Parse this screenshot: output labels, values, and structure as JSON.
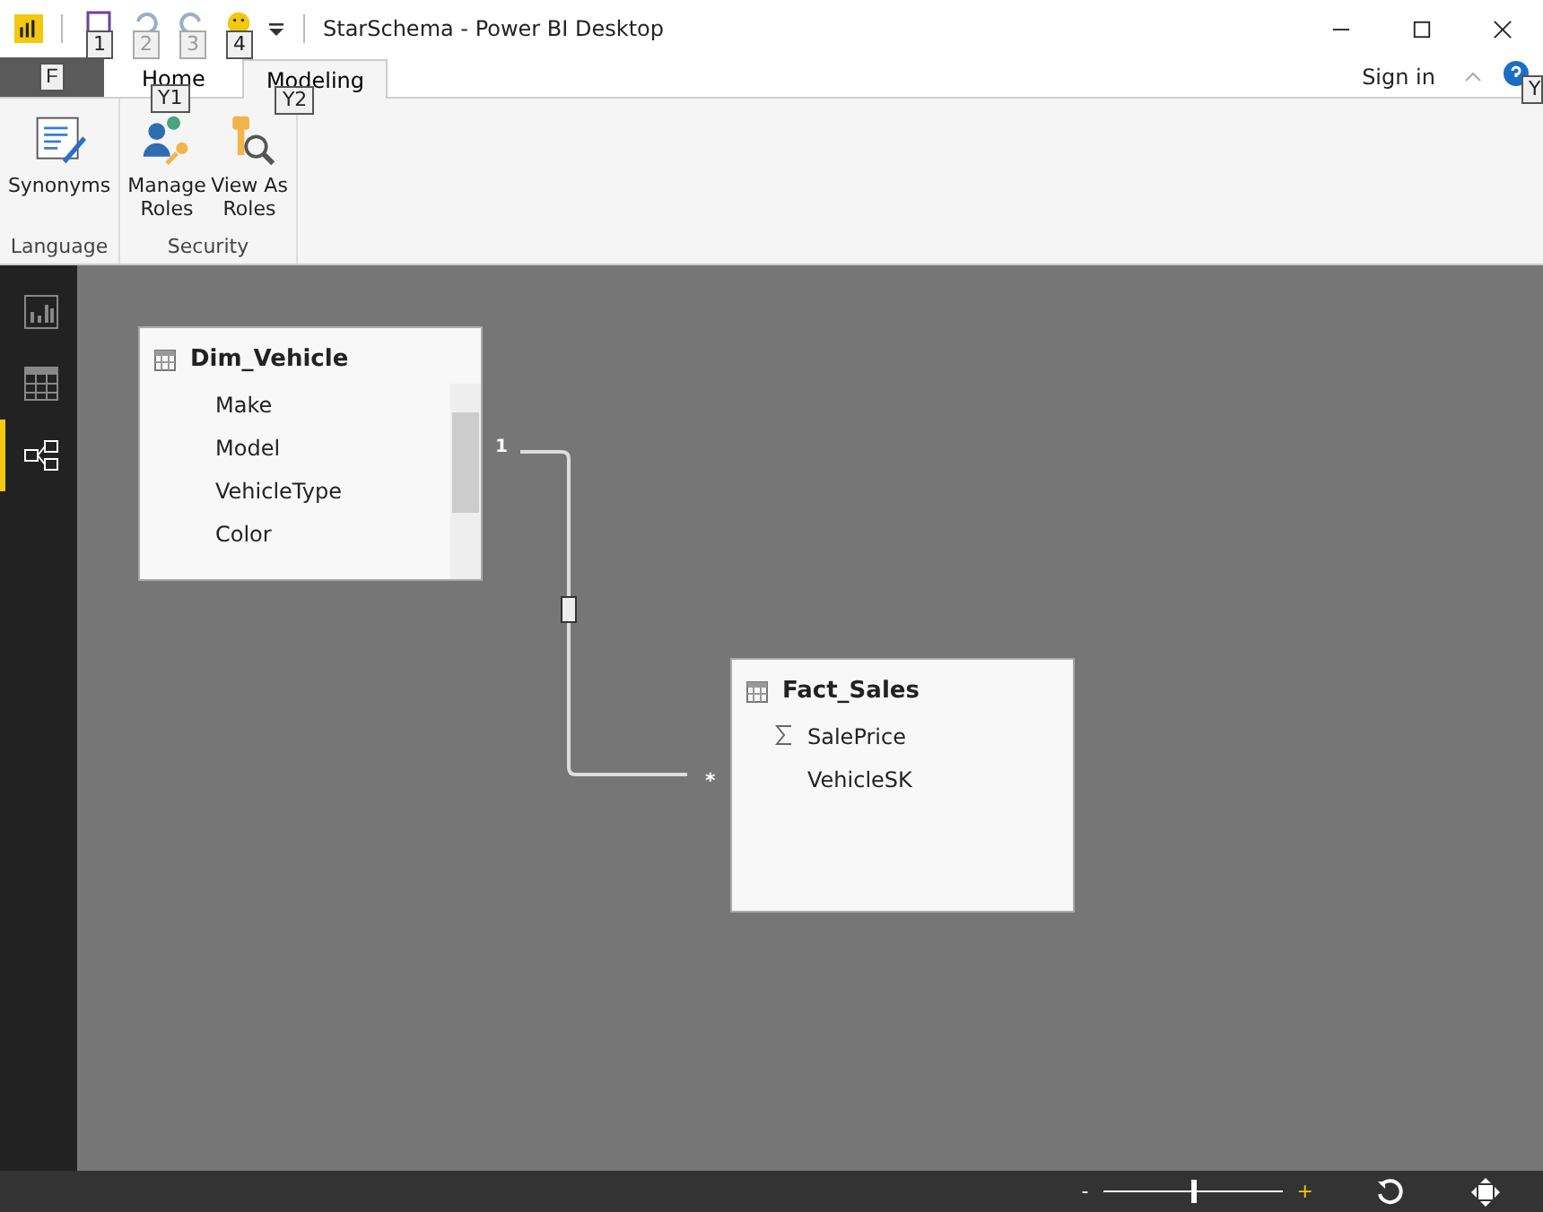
{
  "window": {
    "title": "StarSchema - Power BI Desktop"
  },
  "quick_access_keytips": [
    "1",
    "2",
    "3",
    "4"
  ],
  "tabs": [
    {
      "label": "F",
      "kind": "file",
      "selected": false
    },
    {
      "label": "Home",
      "kind": "tab",
      "keytip": "Y1",
      "selected": false
    },
    {
      "label": "Modeling",
      "kind": "tab",
      "keytip": "Y2",
      "selected": true
    }
  ],
  "sign_in": "Sign in",
  "help_keytip": "Y",
  "ribbon_groups": [
    {
      "label": "Language",
      "buttons": [
        {
          "label": "Synonyms",
          "kind": "synonyms"
        }
      ]
    },
    {
      "label": "Security",
      "buttons": [
        {
          "label": "Manage Roles",
          "kind": "manage"
        },
        {
          "label": "View As Roles",
          "kind": "viewas"
        }
      ]
    }
  ],
  "views": [
    {
      "kind": "report",
      "selected": false
    },
    {
      "kind": "data",
      "selected": false
    },
    {
      "kind": "relationships",
      "selected": true
    }
  ],
  "tables": [
    {
      "name": "Dim_Vehicle",
      "scrollbar": true,
      "fields": [
        {
          "name": "Make",
          "kind": "text"
        },
        {
          "name": "Model",
          "kind": "text"
        },
        {
          "name": "VehicleType",
          "kind": "text"
        },
        {
          "name": "Color",
          "kind": "text"
        }
      ]
    },
    {
      "name": "Fact_Sales",
      "scrollbar": false,
      "fields": [
        {
          "name": "SalePrice",
          "kind": "sum"
        },
        {
          "name": "VehicleSK",
          "kind": "text"
        }
      ]
    }
  ],
  "relationship": {
    "from_label": "1",
    "to_label": "*"
  },
  "zoom": {
    "minus": "-",
    "plus": "+",
    "level": 0.5
  }
}
